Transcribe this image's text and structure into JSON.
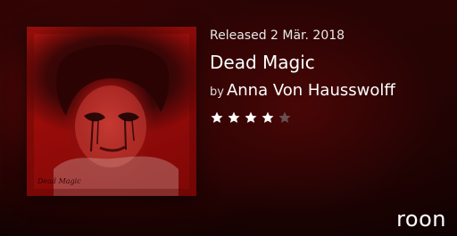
{
  "album": {
    "released": "Released 2 Mär. 2018",
    "title": "Dead Magic",
    "by_label": "by",
    "artist": "Anna Von Hausswolff",
    "cover_signature": "Dead Magic",
    "rating": 4,
    "rating_max": 5
  },
  "brand": {
    "name": "roon"
  },
  "colors": {
    "star_filled": "#ffffff",
    "star_empty": "#6a5050",
    "cover_red": "#a8100d"
  }
}
